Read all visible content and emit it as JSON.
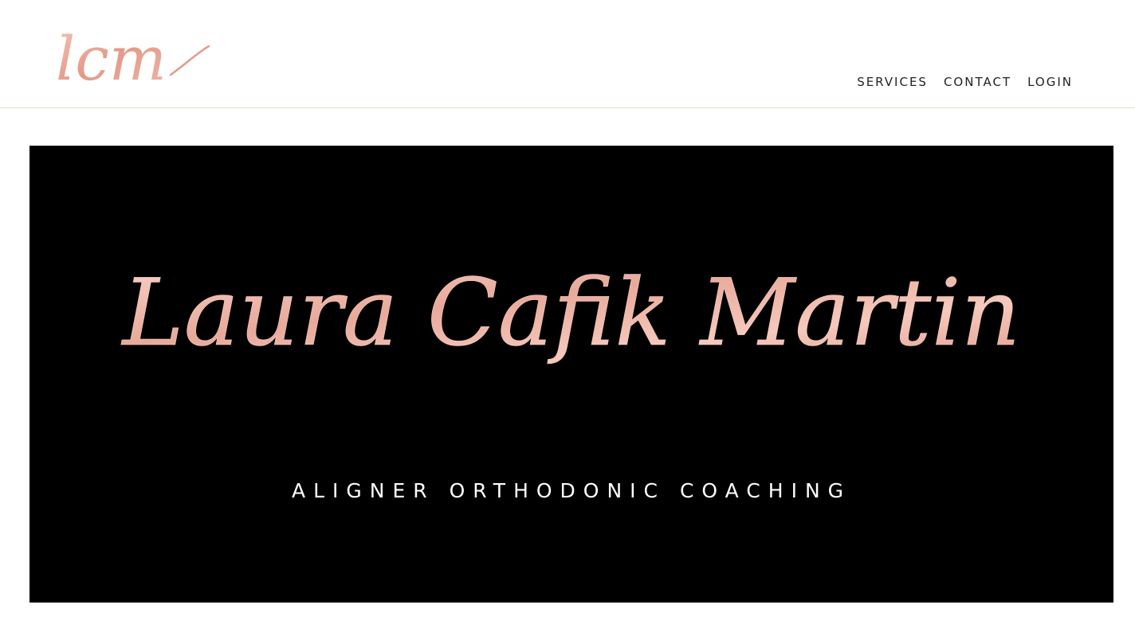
{
  "header": {
    "logo_text": "lcm",
    "nav": {
      "services": "SERVICES",
      "contact": "CONTACT",
      "login": "LOGIN"
    }
  },
  "hero": {
    "title": "Laura Cafik Martin",
    "subtitle": "ALIGNER ORTHODONIC COACHING"
  },
  "colors": {
    "rose_gold": "#e8a99a",
    "rose_gold_light": "#f6c9bd",
    "hero_background": "#000000",
    "header_border": "#e6d8cc",
    "nav_text": "#222222"
  }
}
